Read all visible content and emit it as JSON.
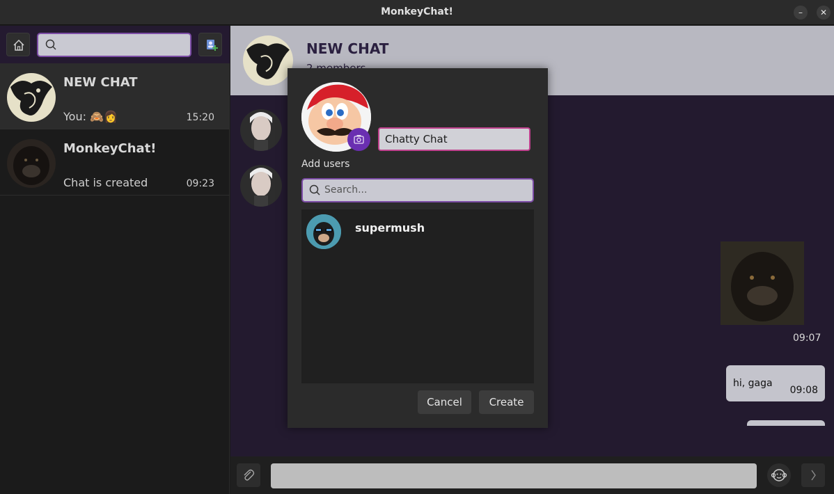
{
  "window": {
    "title": "MonkeyChat!",
    "minimize": "–",
    "close": "✕"
  },
  "sidebar": {
    "search_placeholder": "",
    "chats": [
      {
        "name": "NEW CHAT",
        "last_message": "You: 🙈👩",
        "time": "15:20"
      },
      {
        "name": "MonkeyChat!",
        "last_message": "Chat is created",
        "time": "09:23"
      }
    ]
  },
  "chat": {
    "title": "NEW CHAT",
    "subtitle": "2 members",
    "messages": [
      {
        "time": "09:07"
      },
      {
        "text": "hi, gaga",
        "time": "09:08"
      }
    ],
    "input_placeholder": ""
  },
  "dialog": {
    "chat_name_value": "Chatty Chat",
    "add_users_label": "Add users",
    "search_placeholder": "Search...",
    "users": [
      {
        "name": "supermush"
      }
    ],
    "cancel_label": "Cancel",
    "create_label": "Create"
  },
  "colors": {
    "accent_purple": "#7c4ca6",
    "camera_button": "#6a2fb1",
    "name_field_border": "#c0418e",
    "header_bg": "#b8b8c1",
    "chat_bg": "#231a2f"
  },
  "icons": {
    "home": "home-icon",
    "search": "search-icon",
    "add_contact": "add-contact-icon",
    "attach": "paperclip-icon",
    "emoji": "monkey-emoji-icon",
    "send": "chevron-right-icon",
    "camera": "camera-icon"
  }
}
